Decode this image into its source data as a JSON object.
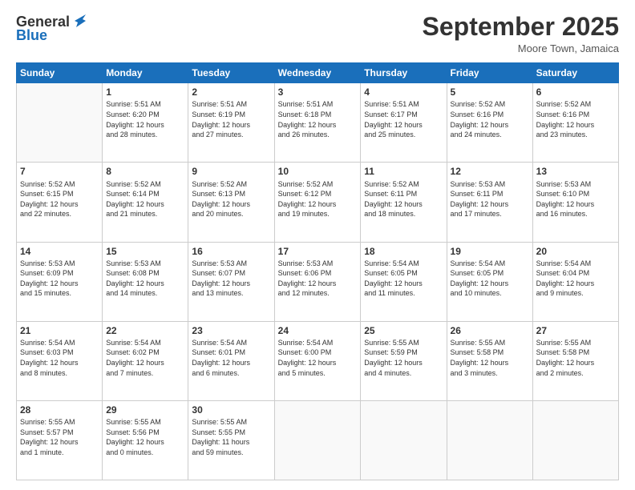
{
  "header": {
    "logo_line1": "General",
    "logo_line2": "Blue",
    "month": "September 2025",
    "location": "Moore Town, Jamaica"
  },
  "weekdays": [
    "Sunday",
    "Monday",
    "Tuesday",
    "Wednesday",
    "Thursday",
    "Friday",
    "Saturday"
  ],
  "weeks": [
    [
      {
        "day": "",
        "info": ""
      },
      {
        "day": "1",
        "info": "Sunrise: 5:51 AM\nSunset: 6:20 PM\nDaylight: 12 hours\nand 28 minutes."
      },
      {
        "day": "2",
        "info": "Sunrise: 5:51 AM\nSunset: 6:19 PM\nDaylight: 12 hours\nand 27 minutes."
      },
      {
        "day": "3",
        "info": "Sunrise: 5:51 AM\nSunset: 6:18 PM\nDaylight: 12 hours\nand 26 minutes."
      },
      {
        "day": "4",
        "info": "Sunrise: 5:51 AM\nSunset: 6:17 PM\nDaylight: 12 hours\nand 25 minutes."
      },
      {
        "day": "5",
        "info": "Sunrise: 5:52 AM\nSunset: 6:16 PM\nDaylight: 12 hours\nand 24 minutes."
      },
      {
        "day": "6",
        "info": "Sunrise: 5:52 AM\nSunset: 6:16 PM\nDaylight: 12 hours\nand 23 minutes."
      }
    ],
    [
      {
        "day": "7",
        "info": "Sunrise: 5:52 AM\nSunset: 6:15 PM\nDaylight: 12 hours\nand 22 minutes."
      },
      {
        "day": "8",
        "info": "Sunrise: 5:52 AM\nSunset: 6:14 PM\nDaylight: 12 hours\nand 21 minutes."
      },
      {
        "day": "9",
        "info": "Sunrise: 5:52 AM\nSunset: 6:13 PM\nDaylight: 12 hours\nand 20 minutes."
      },
      {
        "day": "10",
        "info": "Sunrise: 5:52 AM\nSunset: 6:12 PM\nDaylight: 12 hours\nand 19 minutes."
      },
      {
        "day": "11",
        "info": "Sunrise: 5:52 AM\nSunset: 6:11 PM\nDaylight: 12 hours\nand 18 minutes."
      },
      {
        "day": "12",
        "info": "Sunrise: 5:53 AM\nSunset: 6:11 PM\nDaylight: 12 hours\nand 17 minutes."
      },
      {
        "day": "13",
        "info": "Sunrise: 5:53 AM\nSunset: 6:10 PM\nDaylight: 12 hours\nand 16 minutes."
      }
    ],
    [
      {
        "day": "14",
        "info": "Sunrise: 5:53 AM\nSunset: 6:09 PM\nDaylight: 12 hours\nand 15 minutes."
      },
      {
        "day": "15",
        "info": "Sunrise: 5:53 AM\nSunset: 6:08 PM\nDaylight: 12 hours\nand 14 minutes."
      },
      {
        "day": "16",
        "info": "Sunrise: 5:53 AM\nSunset: 6:07 PM\nDaylight: 12 hours\nand 13 minutes."
      },
      {
        "day": "17",
        "info": "Sunrise: 5:53 AM\nSunset: 6:06 PM\nDaylight: 12 hours\nand 12 minutes."
      },
      {
        "day": "18",
        "info": "Sunrise: 5:54 AM\nSunset: 6:05 PM\nDaylight: 12 hours\nand 11 minutes."
      },
      {
        "day": "19",
        "info": "Sunrise: 5:54 AM\nSunset: 6:05 PM\nDaylight: 12 hours\nand 10 minutes."
      },
      {
        "day": "20",
        "info": "Sunrise: 5:54 AM\nSunset: 6:04 PM\nDaylight: 12 hours\nand 9 minutes."
      }
    ],
    [
      {
        "day": "21",
        "info": "Sunrise: 5:54 AM\nSunset: 6:03 PM\nDaylight: 12 hours\nand 8 minutes."
      },
      {
        "day": "22",
        "info": "Sunrise: 5:54 AM\nSunset: 6:02 PM\nDaylight: 12 hours\nand 7 minutes."
      },
      {
        "day": "23",
        "info": "Sunrise: 5:54 AM\nSunset: 6:01 PM\nDaylight: 12 hours\nand 6 minutes."
      },
      {
        "day": "24",
        "info": "Sunrise: 5:54 AM\nSunset: 6:00 PM\nDaylight: 12 hours\nand 5 minutes."
      },
      {
        "day": "25",
        "info": "Sunrise: 5:55 AM\nSunset: 5:59 PM\nDaylight: 12 hours\nand 4 minutes."
      },
      {
        "day": "26",
        "info": "Sunrise: 5:55 AM\nSunset: 5:58 PM\nDaylight: 12 hours\nand 3 minutes."
      },
      {
        "day": "27",
        "info": "Sunrise: 5:55 AM\nSunset: 5:58 PM\nDaylight: 12 hours\nand 2 minutes."
      }
    ],
    [
      {
        "day": "28",
        "info": "Sunrise: 5:55 AM\nSunset: 5:57 PM\nDaylight: 12 hours\nand 1 minute."
      },
      {
        "day": "29",
        "info": "Sunrise: 5:55 AM\nSunset: 5:56 PM\nDaylight: 12 hours\nand 0 minutes."
      },
      {
        "day": "30",
        "info": "Sunrise: 5:55 AM\nSunset: 5:55 PM\nDaylight: 11 hours\nand 59 minutes."
      },
      {
        "day": "",
        "info": ""
      },
      {
        "day": "",
        "info": ""
      },
      {
        "day": "",
        "info": ""
      },
      {
        "day": "",
        "info": ""
      }
    ]
  ]
}
